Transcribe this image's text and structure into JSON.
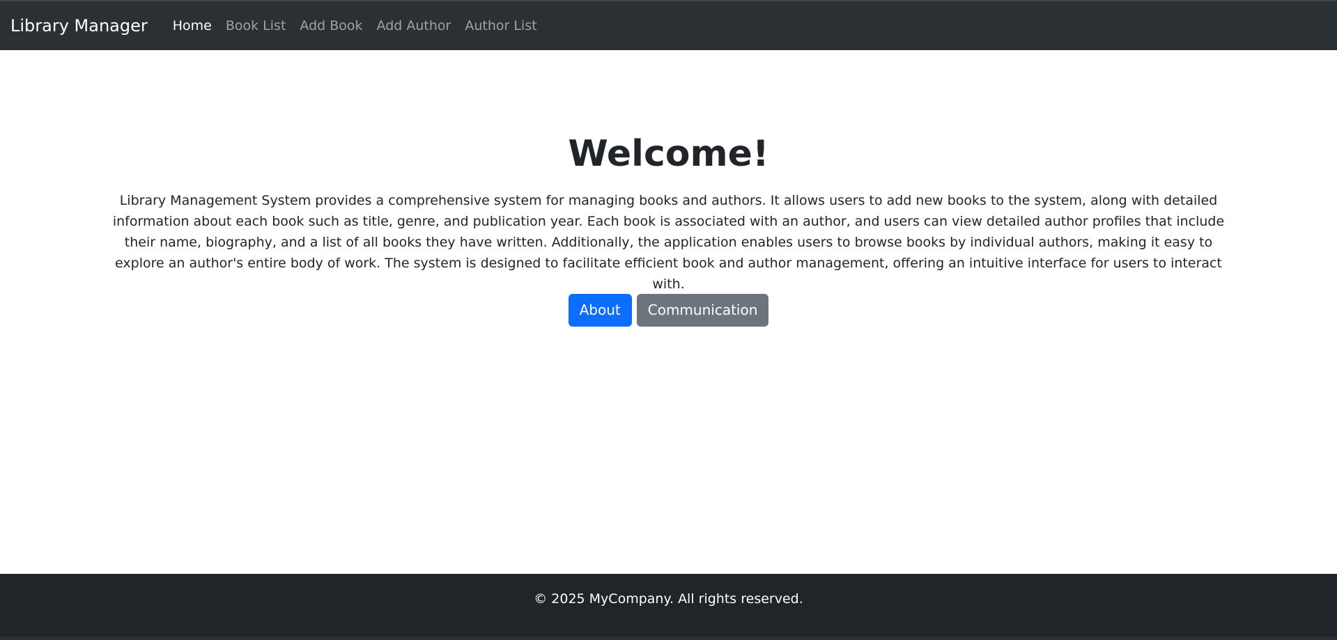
{
  "navbar": {
    "brand": "Library Manager",
    "links": [
      {
        "label": "Home",
        "active": true
      },
      {
        "label": "Book List",
        "active": false
      },
      {
        "label": "Add Book",
        "active": false
      },
      {
        "label": "Add Author",
        "active": false
      },
      {
        "label": "Author List",
        "active": false
      }
    ]
  },
  "main": {
    "title": "Welcome!",
    "description": "Library Management System provides a comprehensive system for managing books and authors. It allows users to add new books to the system, along with detailed information about each book such as title, genre, and publication year. Each book is associated with an author, and users can view detailed author profiles that include their name, biography, and a list of all books they have written. Additionally, the application enables users to browse books by individual authors, making it easy to explore an author's entire body of work. The system is designed to facilitate efficient book and author management, offering an intuitive interface for users to interact with.",
    "buttons": {
      "about": "About",
      "communication": "Communication"
    }
  },
  "footer": {
    "text": "© 2025 MyCompany. All rights reserved."
  },
  "colors": {
    "navbar_bg": "#2b3035",
    "primary": "#0d6efd",
    "secondary": "#6c757d",
    "footer_bg": "#212529"
  }
}
